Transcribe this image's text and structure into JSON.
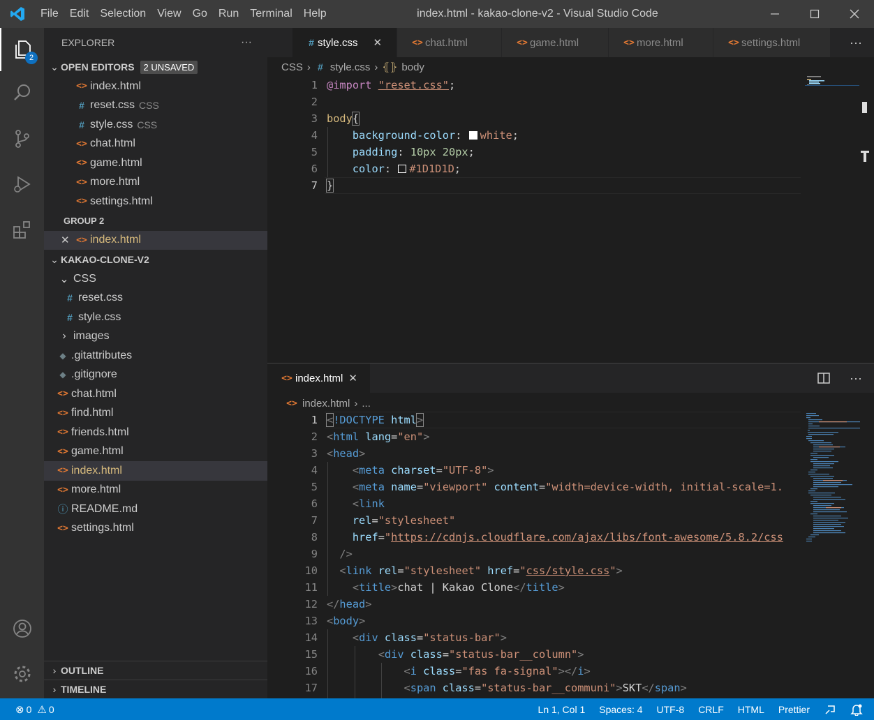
{
  "window": {
    "title": "index.html - kakao-clone-v2 - Visual Studio Code",
    "menus": [
      "File",
      "Edit",
      "Selection",
      "View",
      "Go",
      "Run",
      "Terminal",
      "Help"
    ]
  },
  "activity": {
    "explorer_badge": "2"
  },
  "sidebar": {
    "title": "EXPLORER",
    "more": "···",
    "open_editors": {
      "label": "OPEN EDITORS",
      "badge": "2 UNSAVED",
      "items": [
        {
          "name": "index.html",
          "desc": "",
          "type": "html"
        },
        {
          "name": "reset.css",
          "desc": "CSS",
          "type": "css"
        },
        {
          "name": "style.css",
          "desc": "CSS",
          "type": "css"
        },
        {
          "name": "chat.html",
          "desc": "",
          "type": "html"
        },
        {
          "name": "game.html",
          "desc": "",
          "type": "html"
        },
        {
          "name": "more.html",
          "desc": "",
          "type": "html"
        },
        {
          "name": "settings.html",
          "desc": "",
          "type": "html"
        }
      ],
      "group2_label": "GROUP 2",
      "group2_item": "index.html"
    },
    "project": {
      "label": "KAKAO-CLONE-V2",
      "css_folder": "CSS",
      "css_files": [
        "reset.css",
        "style.css"
      ],
      "images_folder": "images",
      "files": [
        {
          "name": ".gitattributes",
          "type": "git"
        },
        {
          "name": ".gitignore",
          "type": "git"
        },
        {
          "name": "chat.html",
          "type": "html"
        },
        {
          "name": "find.html",
          "type": "html"
        },
        {
          "name": "friends.html",
          "type": "html"
        },
        {
          "name": "game.html",
          "type": "html"
        },
        {
          "name": "index.html",
          "type": "html"
        },
        {
          "name": "more.html",
          "type": "html"
        },
        {
          "name": "README.md",
          "type": "info"
        },
        {
          "name": "settings.html",
          "type": "html"
        }
      ]
    },
    "outline": "OUTLINE",
    "timeline": "TIMELINE"
  },
  "top_editor": {
    "tabs": [
      {
        "label": "style.css",
        "type": "css",
        "active": true
      },
      {
        "label": "chat.html",
        "type": "html"
      },
      {
        "label": "game.html",
        "type": "html"
      },
      {
        "label": "more.html",
        "type": "html"
      },
      {
        "label": "settings.html",
        "type": "html"
      }
    ],
    "breadcrumb": {
      "folder": "CSS",
      "file": "style.css",
      "symbol": "body"
    },
    "lines": [
      "1",
      "2",
      "3",
      "4",
      "5",
      "6",
      "7"
    ],
    "code": {
      "l1_kw": "@import",
      "l1_str": "\"reset.css\"",
      "l1_end": ";",
      "l3_sel": "body",
      "l3_brace": "{",
      "l4_prop": "background-color",
      "l4_val": "white",
      "l5_prop": "padding",
      "l5_val": "10px 20px",
      "l6_prop": "color",
      "l6_val": "#1D1D1D",
      "l7": "}"
    }
  },
  "bottom_editor": {
    "tab": "index.html",
    "breadcrumb": {
      "file": "index.html",
      "rest": "..."
    },
    "lines": [
      "1",
      "2",
      "3",
      "4",
      "5",
      "6",
      "7",
      "8",
      "9",
      "10",
      "11",
      "12",
      "13",
      "14",
      "15",
      "16",
      "17"
    ],
    "code": {
      "l1a": "<",
      "l1b": "!DOCTYPE",
      "l1c": " html",
      "l2a": "html",
      "l2b": "lang",
      "l2c": "\"en\"",
      "l3": "head",
      "l4a": "meta",
      "l4b": "charset",
      "l4c": "\"UTF-8\"",
      "l5a": "meta",
      "l5b": "name",
      "l5c": "\"viewport\"",
      "l5d": "content",
      "l5e": "\"width=device-width, initial-scale=1.",
      "l6": "link",
      "l7a": "rel",
      "l7b": "\"stylesheet\"",
      "l8a": "href",
      "l8b": "\"",
      "l8c": "https://cdnjs.cloudflare.com/ajax/libs/font-awesome/5.8.2/css",
      "l9": "/>",
      "l10a": "link",
      "l10b": "rel",
      "l10c": "\"stylesheet\"",
      "l10d": "href",
      "l10e": "\"",
      "l10f": "css/style.css",
      "l10g": "\"",
      "l11a": "title",
      "l11b": "chat | Kakao Clone",
      "l11c": "title",
      "l12": "head",
      "l13": "body",
      "l14a": "div",
      "l14b": "class",
      "l14c": "\"status-bar\"",
      "l15a": "div",
      "l15b": "class",
      "l15c": "\"status-bar__column\"",
      "l16a": "i",
      "l16b": "class",
      "l16c": "\"fas fa-signal\"",
      "l16d": "i",
      "l17a": "span",
      "l17b": "class",
      "l17c": "\"status-bar__communi\"",
      "l17d": "SKT",
      "l17e": "span"
    }
  },
  "statusbar": {
    "errors": "0",
    "warnings": "0",
    "position": "Ln 1, Col 1",
    "spaces": "Spaces: 4",
    "encoding": "UTF-8",
    "eol": "CRLF",
    "language": "HTML",
    "formatter": "Prettier"
  }
}
